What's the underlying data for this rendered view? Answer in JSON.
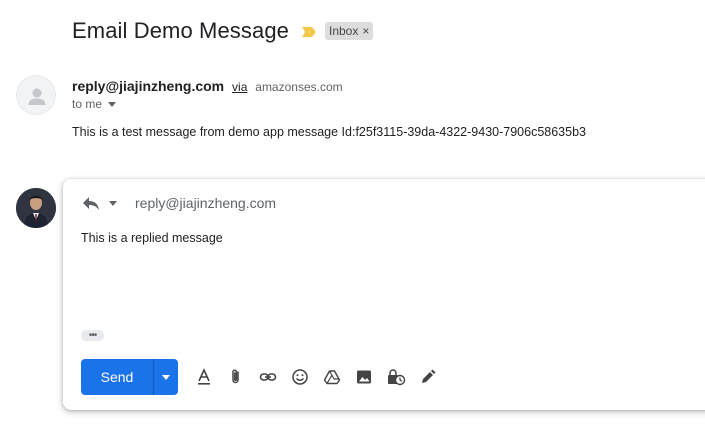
{
  "subject": {
    "title": "Email Demo Message",
    "label": "Inbox",
    "label_remove": "×"
  },
  "message": {
    "sender_email": "reply@jiajinzheng.com",
    "via_text": "via",
    "via_domain": "amazonses.com",
    "to_text": "to me",
    "body": "This is a test message from demo app message Id:f25f3115-39da-4322-9430-7906c58635b3"
  },
  "reply": {
    "to_address": "reply@jiajinzheng.com",
    "body": "This is a replied message",
    "trim_label": "•••",
    "send_label": "Send"
  },
  "colors": {
    "accent": "#1a73e8",
    "importance": "#f2c94c"
  },
  "icons": {
    "importance": "importance-marker-icon",
    "reply_type": "reply-arrow-icon",
    "toolbar": [
      "formatting-options-icon",
      "attach-file-icon",
      "insert-link-icon",
      "insert-emoji-icon",
      "google-drive-icon",
      "insert-photo-icon",
      "confidential-mode-icon",
      "signature-pen-icon"
    ]
  }
}
